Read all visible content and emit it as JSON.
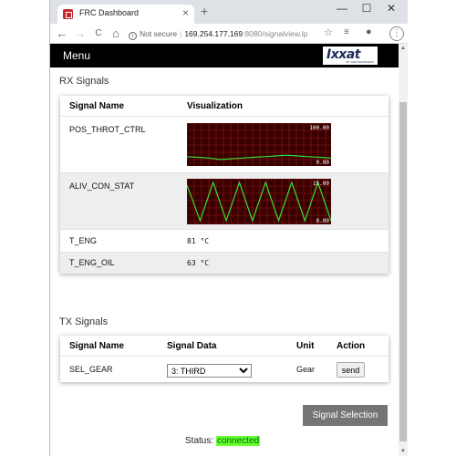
{
  "browser": {
    "tab_title": "FRC Dashboard",
    "tab_close": "×",
    "new_tab": "+",
    "window_controls": {
      "minimize": "—",
      "maximize": "☐",
      "close": "✕"
    },
    "nav": {
      "back": "←",
      "forward": "→",
      "reload": "C",
      "home": "⌂"
    },
    "security_label": "Not secure",
    "url_host": "169.254.177.169",
    "url_rest": ":8080/signalview.lp",
    "icons": [
      "info-icon",
      "star-icon",
      "extensions-icon",
      "account-icon",
      "menu-icon"
    ]
  },
  "menubar": {
    "menu_label": "Menu",
    "logo_text": "Ixxat",
    "logo_sub": "BY HMS NETWORKS"
  },
  "rx": {
    "title": "RX Signals",
    "headers": {
      "name": "Signal Name",
      "viz": "Visualization"
    },
    "rows": [
      {
        "name": "POS_THROT_CTRL",
        "type": "chart",
        "max_label": "100.00",
        "min_label": "0.00"
      },
      {
        "name": "ALIV_CON_STAT",
        "type": "chart",
        "max_label": "15.00",
        "min_label": "0.00"
      },
      {
        "name": "T_ENG",
        "type": "value",
        "value": "81 °C"
      },
      {
        "name": "T_ENG_OIL",
        "type": "value",
        "value": "63 °C"
      }
    ]
  },
  "tx": {
    "title": "TX Signals",
    "headers": {
      "name": "Signal Name",
      "data": "Signal Data",
      "unit": "Unit",
      "action": "Action"
    },
    "rows": [
      {
        "name": "SEL_GEAR",
        "selected": "3: THIRD",
        "unit": "Gear",
        "action": "send"
      }
    ]
  },
  "signal_selection_button": "Signal Selection",
  "status": {
    "label": "Status:",
    "value": "connected"
  },
  "colors": {
    "menubar_bg": "#000000",
    "chart_bg": "#3a0000",
    "chart_grid": "#8b1a1a",
    "chart_line": "#33dd33",
    "status_bg": "#66ff33",
    "button_bg": "#757575"
  },
  "chart_data": [
    {
      "type": "line",
      "series": [
        {
          "values": [
            16,
            14,
            12,
            8,
            10,
            12,
            14,
            16,
            18,
            20,
            18,
            16,
            14,
            12
          ]
        }
      ],
      "ylim": [
        0,
        100
      ]
    },
    {
      "type": "line",
      "series": [
        {
          "values": [
            14,
            0,
            15,
            0,
            15,
            0,
            15,
            0,
            15,
            0,
            15,
            0
          ]
        }
      ],
      "ylim": [
        0,
        15
      ]
    }
  ]
}
